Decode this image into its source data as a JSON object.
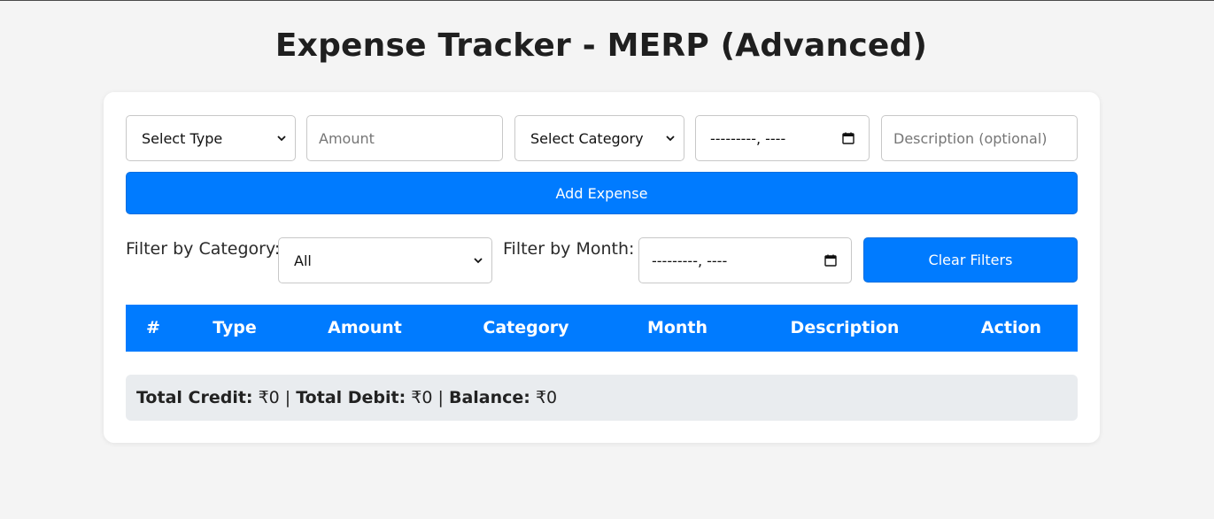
{
  "page": {
    "title": "Expense Tracker - MERP (Advanced)"
  },
  "form": {
    "type_select": {
      "selected": "Select Type"
    },
    "amount_input": {
      "placeholder": "Amount"
    },
    "category_select": {
      "selected": "Select Category"
    },
    "month_input": {
      "value": "---------, ----"
    },
    "description_input": {
      "placeholder": "Description (optional)"
    },
    "add_button": "Add Expense"
  },
  "filters": {
    "category_label": "Filter by Category:",
    "category_selected": "All",
    "month_label": "Filter by Month:",
    "month_value": "---------, ----",
    "clear_button": "Clear Filters"
  },
  "table": {
    "headers": [
      "#",
      "Type",
      "Amount",
      "Category",
      "Month",
      "Description",
      "Action"
    ],
    "rows": []
  },
  "summary": {
    "credit_label": "Total Credit:",
    "credit_value": "₹0",
    "debit_label": "Total Debit:",
    "debit_value": "₹0",
    "balance_label": "Balance:",
    "balance_value": "₹0",
    "separator": "|"
  },
  "colors": {
    "accent": "#007bff",
    "background": "#f4f4f4",
    "summary_bg": "#e9ecef"
  },
  "icons": {
    "select_arrow": "chevron-down-icon",
    "date_picker": "calendar-icon"
  }
}
